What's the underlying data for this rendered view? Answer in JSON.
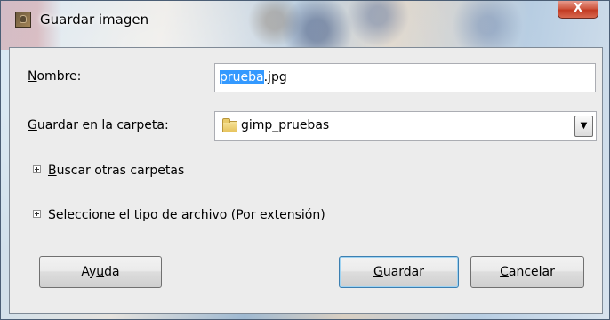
{
  "window": {
    "title": "Guardar imagen",
    "close_symbol": "X"
  },
  "form": {
    "name_label_mnemonic": "N",
    "name_label_rest": "ombre:",
    "name_value_selected": "prueba",
    "name_value_rest": ".jpg",
    "folder_label_mnemonic": "G",
    "folder_label_rest": "uardar en la carpeta:",
    "folder_value": "gimp_pruebas",
    "folder_arrow": "▼"
  },
  "expanders": {
    "browse_mnemonic": "B",
    "browse_rest": "uscar otras carpetas",
    "filetype_before": "Seleccione el ",
    "filetype_mnemonic": "t",
    "filetype_after": "ipo de archivo (Por extensión)"
  },
  "buttons": {
    "help_before": "Ay",
    "help_mnemonic": "u",
    "help_after": "da",
    "save_mnemonic": "G",
    "save_rest": "uardar",
    "cancel_mnemonic": "C",
    "cancel_rest": "ancelar"
  },
  "colors": {
    "selection": "#3399ff",
    "close_button": "#c23a22",
    "dialog_background": "#ececec"
  }
}
